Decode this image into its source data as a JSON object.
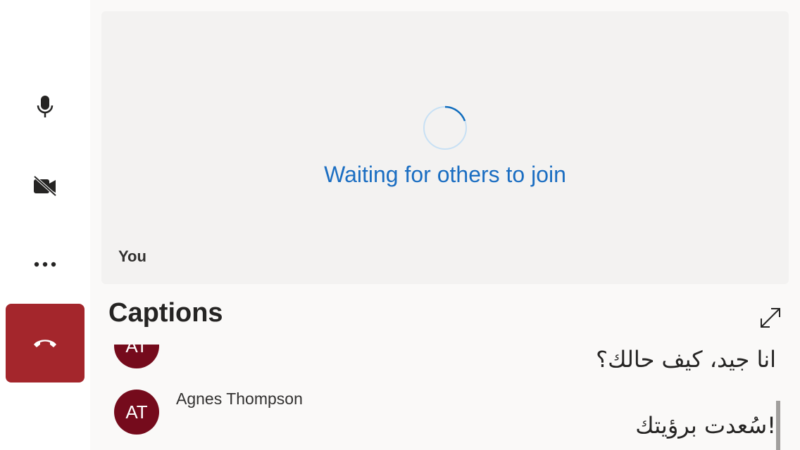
{
  "controls": {
    "mic_icon": "microphone-icon",
    "camera_icon": "camera-off-icon",
    "more_icon": "more-icon",
    "hangup_icon": "hang-up-icon",
    "hangup_color": "#a4262c"
  },
  "video": {
    "status": "Waiting for others to join",
    "self_label": "You",
    "status_color": "#1b6ec2"
  },
  "captions": {
    "title": "Captions",
    "expand_icon": "expand-icon",
    "items": [
      {
        "initials": "AT",
        "text": "انا جيد، كيف حالك؟"
      },
      {
        "initials": "AT",
        "speaker": "Agnes Thompson",
        "text": "!سُعدت برؤيتك"
      }
    ],
    "avatar_color": "#750b1c"
  }
}
